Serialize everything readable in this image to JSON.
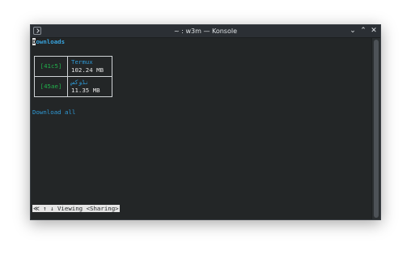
{
  "window": {
    "title": "~ : w3m — Konsole",
    "controls": {
      "minimize": "⌄",
      "maximize": "⌃",
      "close": "✕"
    }
  },
  "page": {
    "heading_first": "D",
    "heading_rest": "ownloads",
    "downloads": [
      {
        "hash": "[41c5]",
        "name": "Termux",
        "size": "102.24 MB"
      },
      {
        "hash": "[45ae]",
        "name": "نڈوکس",
        "size": "11.35 MB"
      }
    ],
    "download_all": "Download all"
  },
  "status_bar": {
    "text": "≪ ↑ ↓ Viewing <Sharing>"
  },
  "colors": {
    "terminal_bg": "#232627",
    "link": "#2f9ad6",
    "heading": "#38a3dd",
    "hash": "#22b14c"
  }
}
